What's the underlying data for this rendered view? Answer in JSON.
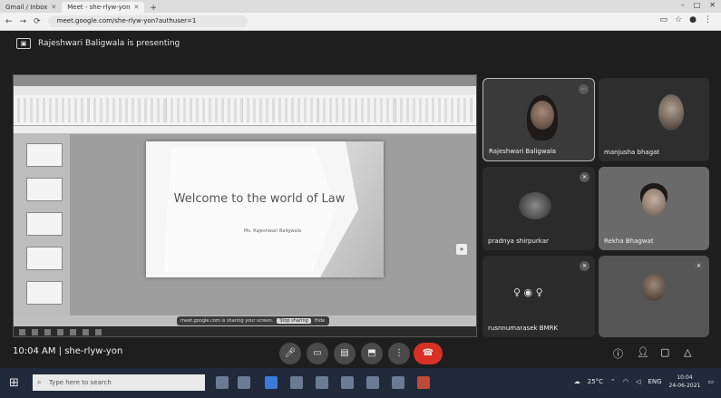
{
  "browser": {
    "tabs": [
      {
        "label": "Gmail / Inbox",
        "active": false
      },
      {
        "label": "Meet - she-rlyw-yon",
        "active": true
      }
    ],
    "new_tab": "+",
    "window_controls": [
      "–",
      "□",
      "✕"
    ],
    "url": "meet.google.com/she-rlyw-yon?authuser=1"
  },
  "meet": {
    "presenting_text": "Rajeshwari Baligwala is presenting",
    "presentation": {
      "slide_title": "Welcome to the world of Law",
      "slide_subtitle": "Ms. Rajeshwari Baligwala",
      "sharing_notice": "meet.google.com is sharing your screen.",
      "stop_sharing": "Stop sharing",
      "hide": "Hide"
    },
    "participants": [
      {
        "name": "Rajeshwari Baligwala"
      },
      {
        "name": "manjusha bhagat"
      },
      {
        "name": "pradnya shirpurkar"
      },
      {
        "name": "Rekha Bhagwat"
      },
      {
        "name": "rusnnumarasek BMRK"
      },
      {
        "name": ""
      }
    ],
    "time_code": "10:04 AM | she-rlyw-yon"
  },
  "taskbar": {
    "search_placeholder": "Type here to search",
    "weather": "25°C",
    "language": "ENG",
    "time": "10:04",
    "date": "24-06-2021"
  },
  "colors": {
    "meet_bg": "#1e1e1e",
    "end_call": "#d93025",
    "taskbar_bg": "#202a3a"
  }
}
